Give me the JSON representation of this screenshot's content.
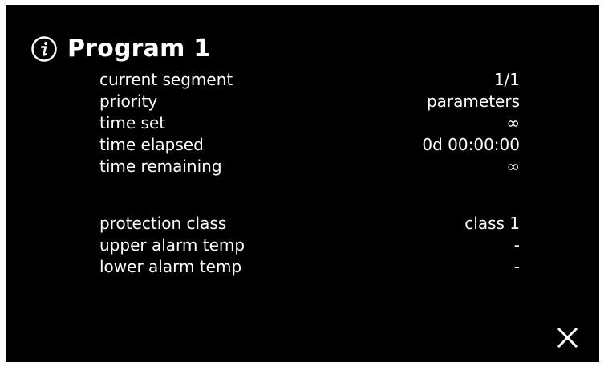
{
  "header": {
    "icon": "info-icon",
    "title": "Program 1"
  },
  "details": [
    {
      "label": "current segment",
      "value": "1/1"
    },
    {
      "label": "priority",
      "value": "parameters"
    },
    {
      "label": "time set",
      "value": "∞"
    },
    {
      "label": "time elapsed",
      "value": "0d 00:00:00"
    },
    {
      "label": "time remaining",
      "value": "∞"
    }
  ],
  "alarms": [
    {
      "label": "protection class",
      "value": "class 1"
    },
    {
      "label": "upper alarm temp",
      "value": "-"
    },
    {
      "label": "lower alarm temp",
      "value": "-"
    }
  ],
  "close_icon": "close-icon",
  "colors": {
    "background": "#000000",
    "text": "#ffffff"
  }
}
